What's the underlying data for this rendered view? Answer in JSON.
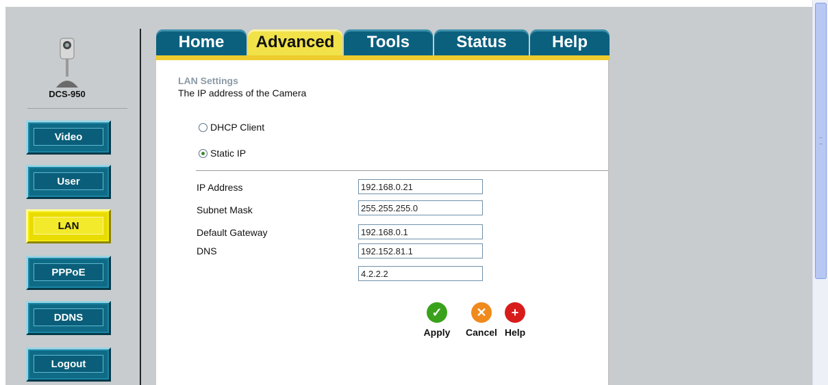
{
  "device": {
    "model": "DCS-950"
  },
  "sidebar": {
    "buttons": [
      {
        "label": "Video",
        "active": false
      },
      {
        "label": "User",
        "active": false
      },
      {
        "label": "LAN",
        "active": true
      },
      {
        "label": "PPPoE",
        "active": false
      },
      {
        "label": "DDNS",
        "active": false
      },
      {
        "label": "Logout",
        "active": false
      }
    ]
  },
  "tabs": [
    {
      "label": "Home",
      "active": false
    },
    {
      "label": "Advanced",
      "active": true
    },
    {
      "label": "Tools",
      "active": false
    },
    {
      "label": "Status",
      "active": false
    },
    {
      "label": "Help",
      "active": false
    }
  ],
  "lan": {
    "title": "LAN Settings",
    "description": "The IP address of the Camera",
    "modes": [
      {
        "label": "DHCP Client",
        "checked": false
      },
      {
        "label": "Static IP",
        "checked": true
      }
    ],
    "fields": {
      "ip_address": {
        "label": "IP Address",
        "value": "192.168.0.21"
      },
      "subnet_mask": {
        "label": "Subnet Mask",
        "value": "255.255.255.0"
      },
      "default_gateway": {
        "label": "Default Gateway",
        "value": "192.168.0.1"
      },
      "dns": {
        "label": "DNS",
        "value": "192.152.81.1"
      },
      "dns_secondary": {
        "value": "4.2.2.2"
      }
    }
  },
  "actions": {
    "apply": {
      "label": "Apply",
      "icon": "checkmark-icon",
      "color": "#3aa21a"
    },
    "cancel": {
      "label": "Cancel",
      "icon": "cancel-x-icon",
      "color": "#f08a1c"
    },
    "help": {
      "label": "Help",
      "icon": "plus-help-icon",
      "color": "#d81c1c"
    }
  }
}
